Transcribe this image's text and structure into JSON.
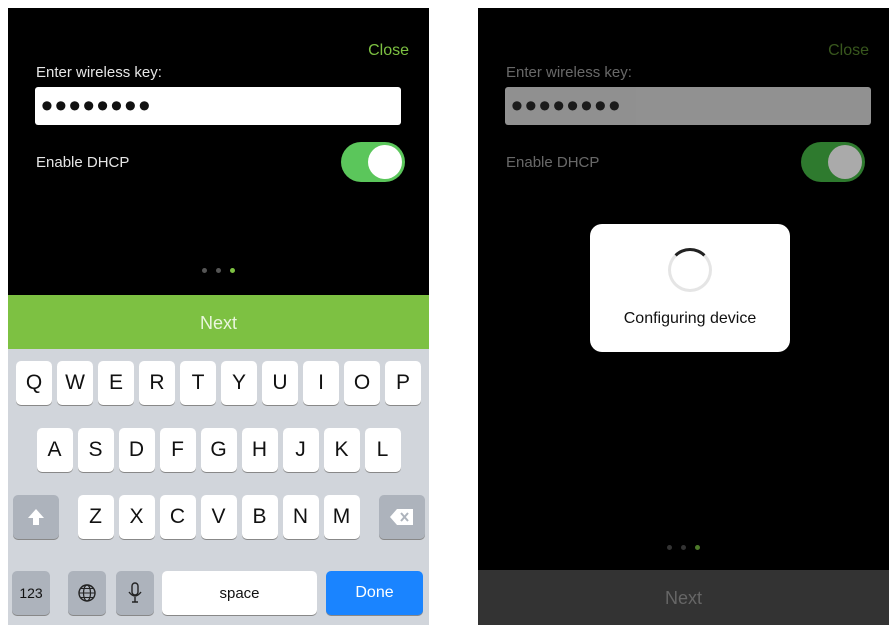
{
  "screens": {
    "left": {
      "close_label": "Close",
      "key_label": "Enter wireless key:",
      "key_masked": "••••••••",
      "dhcp_label": "Enable DHCP",
      "dhcp_enabled": true,
      "pager_total": 3,
      "pager_active": 3,
      "next_label": "Next"
    },
    "right": {
      "close_label": "Close",
      "key_label": "Enter wireless key:",
      "key_masked": "••••••••",
      "dhcp_label": "Enable DHCP",
      "dhcp_enabled": true,
      "modal_text": "Configuring device",
      "pager_total": 3,
      "pager_active": 3,
      "next_label": "Next"
    }
  },
  "keyboard": {
    "row1": [
      "Q",
      "W",
      "E",
      "R",
      "T",
      "Y",
      "U",
      "I",
      "O",
      "P"
    ],
    "row2": [
      "A",
      "S",
      "D",
      "F",
      "G",
      "H",
      "J",
      "K",
      "L"
    ],
    "row3": [
      "Z",
      "X",
      "C",
      "V",
      "B",
      "N",
      "M"
    ],
    "bottom": {
      "numbers": "123",
      "space": "space",
      "done": "Done"
    },
    "icons": {
      "shift": "shift-icon",
      "delete": "delete-icon",
      "globe": "globe-icon",
      "mic": "mic-icon"
    }
  },
  "colors": {
    "accent": "#7dc142",
    "toggle_on": "#5bc65b",
    "done_blue": "#1a84ff"
  }
}
